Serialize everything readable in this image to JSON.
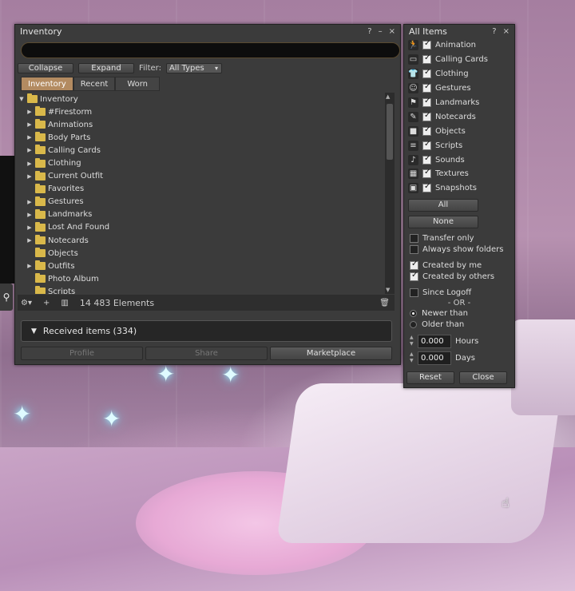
{
  "inventory": {
    "title": "Inventory",
    "search_value": "",
    "collapse_label": "Collapse",
    "expand_label": "Expand",
    "filter_label": "Filter:",
    "filter_type": "All Types",
    "tabs": [
      {
        "label": "Inventory"
      },
      {
        "label": "Recent"
      },
      {
        "label": "Worn"
      }
    ],
    "root": "Inventory",
    "folders": [
      {
        "label": "#Firestorm"
      },
      {
        "label": "Animations"
      },
      {
        "label": "Body Parts"
      },
      {
        "label": "Calling Cards"
      },
      {
        "label": "Clothing"
      },
      {
        "label": "Current Outfit"
      },
      {
        "label": "Favorites"
      },
      {
        "label": "Gestures"
      },
      {
        "label": "Landmarks"
      },
      {
        "label": "Lost And Found"
      },
      {
        "label": "Notecards"
      },
      {
        "label": "Objects"
      },
      {
        "label": "Outfits"
      },
      {
        "label": "Photo Album"
      },
      {
        "label": "Scripts"
      }
    ],
    "element_count": "14 483 Elements",
    "received_items": "Received items (334)",
    "footer_buttons": {
      "profile": "Profile",
      "share": "Share",
      "marketplace": "Marketplace"
    }
  },
  "filters": {
    "title": "All Items",
    "categories": [
      {
        "label": "Animation",
        "icon": "animation-icon"
      },
      {
        "label": "Calling Cards",
        "icon": "calling-card-icon"
      },
      {
        "label": "Clothing",
        "icon": "clothing-icon"
      },
      {
        "label": "Gestures",
        "icon": "gesture-icon"
      },
      {
        "label": "Landmarks",
        "icon": "landmark-icon"
      },
      {
        "label": "Notecards",
        "icon": "notecard-icon"
      },
      {
        "label": "Objects",
        "icon": "object-icon"
      },
      {
        "label": "Scripts",
        "icon": "script-icon"
      },
      {
        "label": "Sounds",
        "icon": "sound-icon"
      },
      {
        "label": "Textures",
        "icon": "texture-icon"
      },
      {
        "label": "Snapshots",
        "icon": "snapshot-icon"
      }
    ],
    "all_button": "All",
    "none_button": "None",
    "transfer_only": "Transfer only",
    "always_show_folders": "Always show folders",
    "created_by_me": "Created by me",
    "created_by_others": "Created by others",
    "since_logoff": "Since Logoff",
    "or_label": "- OR -",
    "newer_than": "Newer than",
    "older_than": "Older than",
    "hours_value": "0.000",
    "hours_label": "Hours",
    "days_value": "0.000",
    "days_label": "Days",
    "reset_button": "Reset",
    "close_button": "Close"
  },
  "window_controls": {
    "help": "?",
    "minimize": "–",
    "close": "×"
  }
}
